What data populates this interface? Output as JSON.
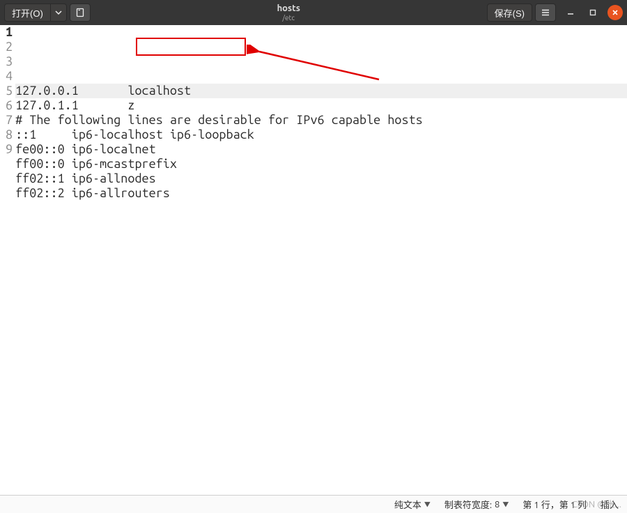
{
  "header": {
    "open_label": "打开(O)",
    "save_label": "保存(S)",
    "title": "hosts",
    "subtitle": "/etc"
  },
  "editor": {
    "current_line_index": 0,
    "lines": [
      "127.0.0.1       localhost",
      "127.0.1.1       z",
      "",
      "# The following lines are desirable for IPv6 capable hosts",
      "::1     ip6-localhost ip6-loopback",
      "fe00::0 ip6-localnet",
      "ff00::0 ip6-mcastprefix",
      "ff02::1 ip6-allnodes",
      "ff02::2 ip6-allrouters"
    ]
  },
  "statusbar": {
    "lang": "纯文本",
    "tabwidth_label": "制表符宽度:",
    "tabwidth_value": "8",
    "cursor": "第 1 行，第 1 列",
    "mode": "插入"
  },
  "watermark": "CSDN @张..."
}
